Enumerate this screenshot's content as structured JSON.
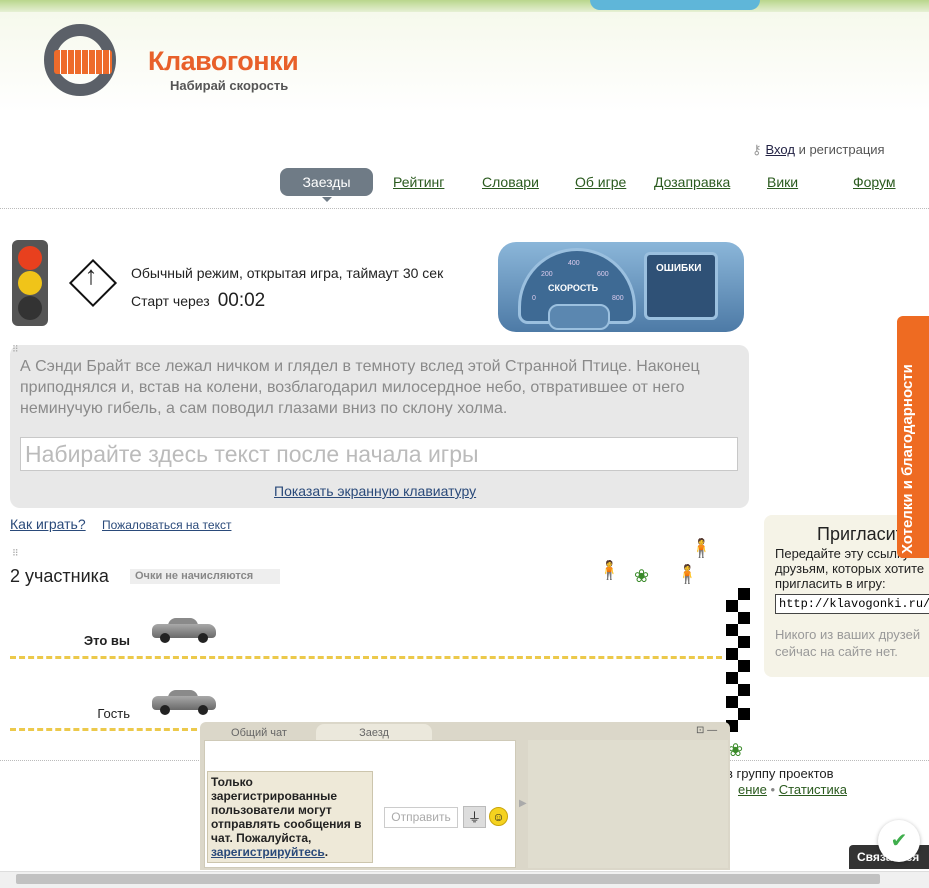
{
  "logo": {
    "title": "Клавогонки",
    "subtitle": "Набирай скорость"
  },
  "login": {
    "link": "Вход",
    "rest": " и регистрация"
  },
  "nav": {
    "active": "Заезды",
    "items": [
      "Рейтинг",
      "Словари",
      "Об игре",
      "Дозаправка",
      "Вики",
      "Форум"
    ]
  },
  "status": {
    "mode": "Обычный режим, открытая игра, таймаут 30 сек",
    "start_label": "Старт через",
    "timer": "00:02"
  },
  "dashboard": {
    "speed_label": "СКОРОСТЬ",
    "errors_label": "ОШИБКИ",
    "ticks": [
      "0",
      "200",
      "400",
      "600",
      "800"
    ]
  },
  "text": {
    "passage": "А Сэнди Брайт все лежал ничком и глядел в темноту вслед этой Странной Птице. Наконец приподнялся и, встав на колени, возблагодарил милосердное небо, отвратившее от него неминучую гибель, а сам поводил глазами вниз по склону холма.",
    "input_placeholder": "Набирайте здесь текст после начала игры",
    "keyboard_link": "Показать экранную клавиатуру"
  },
  "help": {
    "howto": "Как играть?",
    "complain": "Пожаловаться на текст"
  },
  "participants": {
    "count": "2 участника",
    "points_note": "Очки не начисляются",
    "players": [
      {
        "label": "Это вы",
        "bold": true
      },
      {
        "label": "Гость",
        "bold": false
      }
    ]
  },
  "invite": {
    "title": "Пригласите",
    "text": "Передайте эту ссылку друзьям, которых хотите пригласить в игру:",
    "url": "http://klavogonki.ru/g/?gmid",
    "none": "Никого из ваших друзей сейчас на сайте нет."
  },
  "wishes": "Хотелки и благодарности",
  "footer": {
    "line1": "в группу проектов",
    "line2_a": "ение",
    "line2_sep": " • ",
    "line2_b": "Статистика"
  },
  "chat": {
    "tab_general": "Общий чат",
    "tab_race": "Заезд",
    "notice": "Только зарегистрированные пользователи могут отправлять сообщения в чат. Пожалуйста,",
    "notice_link": "зарегистрируйтесь",
    "notice_end": ".",
    "send": "Отправить"
  },
  "contact": "Связаться",
  "colors": {
    "accent": "#ee6b22",
    "nav_active": "#6f7b86",
    "link": "#2a5a1e",
    "lane": "#ecc94b"
  }
}
